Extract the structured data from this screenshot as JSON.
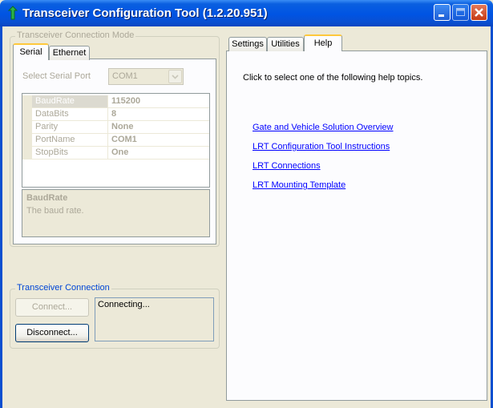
{
  "window": {
    "title": "Transceiver Configuration Tool (1.2.20.951)"
  },
  "connection_mode": {
    "legend": "Transceiver Connection Mode",
    "tabs": [
      "Serial",
      "Ethernet"
    ],
    "serial_port_label": "Select Serial Port",
    "serial_port_value": "COM1",
    "properties": [
      {
        "name": "BaudRate",
        "value": "115200"
      },
      {
        "name": "DataBits",
        "value": "8"
      },
      {
        "name": "Parity",
        "value": "None"
      },
      {
        "name": "PortName",
        "value": "COM1"
      },
      {
        "name": "StopBits",
        "value": "One"
      }
    ],
    "help_title": "BaudRate",
    "help_description": "The baud rate."
  },
  "transceiver_connection": {
    "legend": "Transceiver Connection",
    "connect_label": "Connect...",
    "disconnect_label": "Disconnect...",
    "status_text": "Connecting..."
  },
  "right_tabs": [
    "Settings",
    "Utilities",
    "Help"
  ],
  "help_page": {
    "intro": "Click to select one of the following help topics.",
    "links": [
      "Gate and Vehicle Solution Overview",
      "LRT Configuration Tool Instructions",
      "LRT Connections",
      "LRT Mounting Template"
    ]
  }
}
